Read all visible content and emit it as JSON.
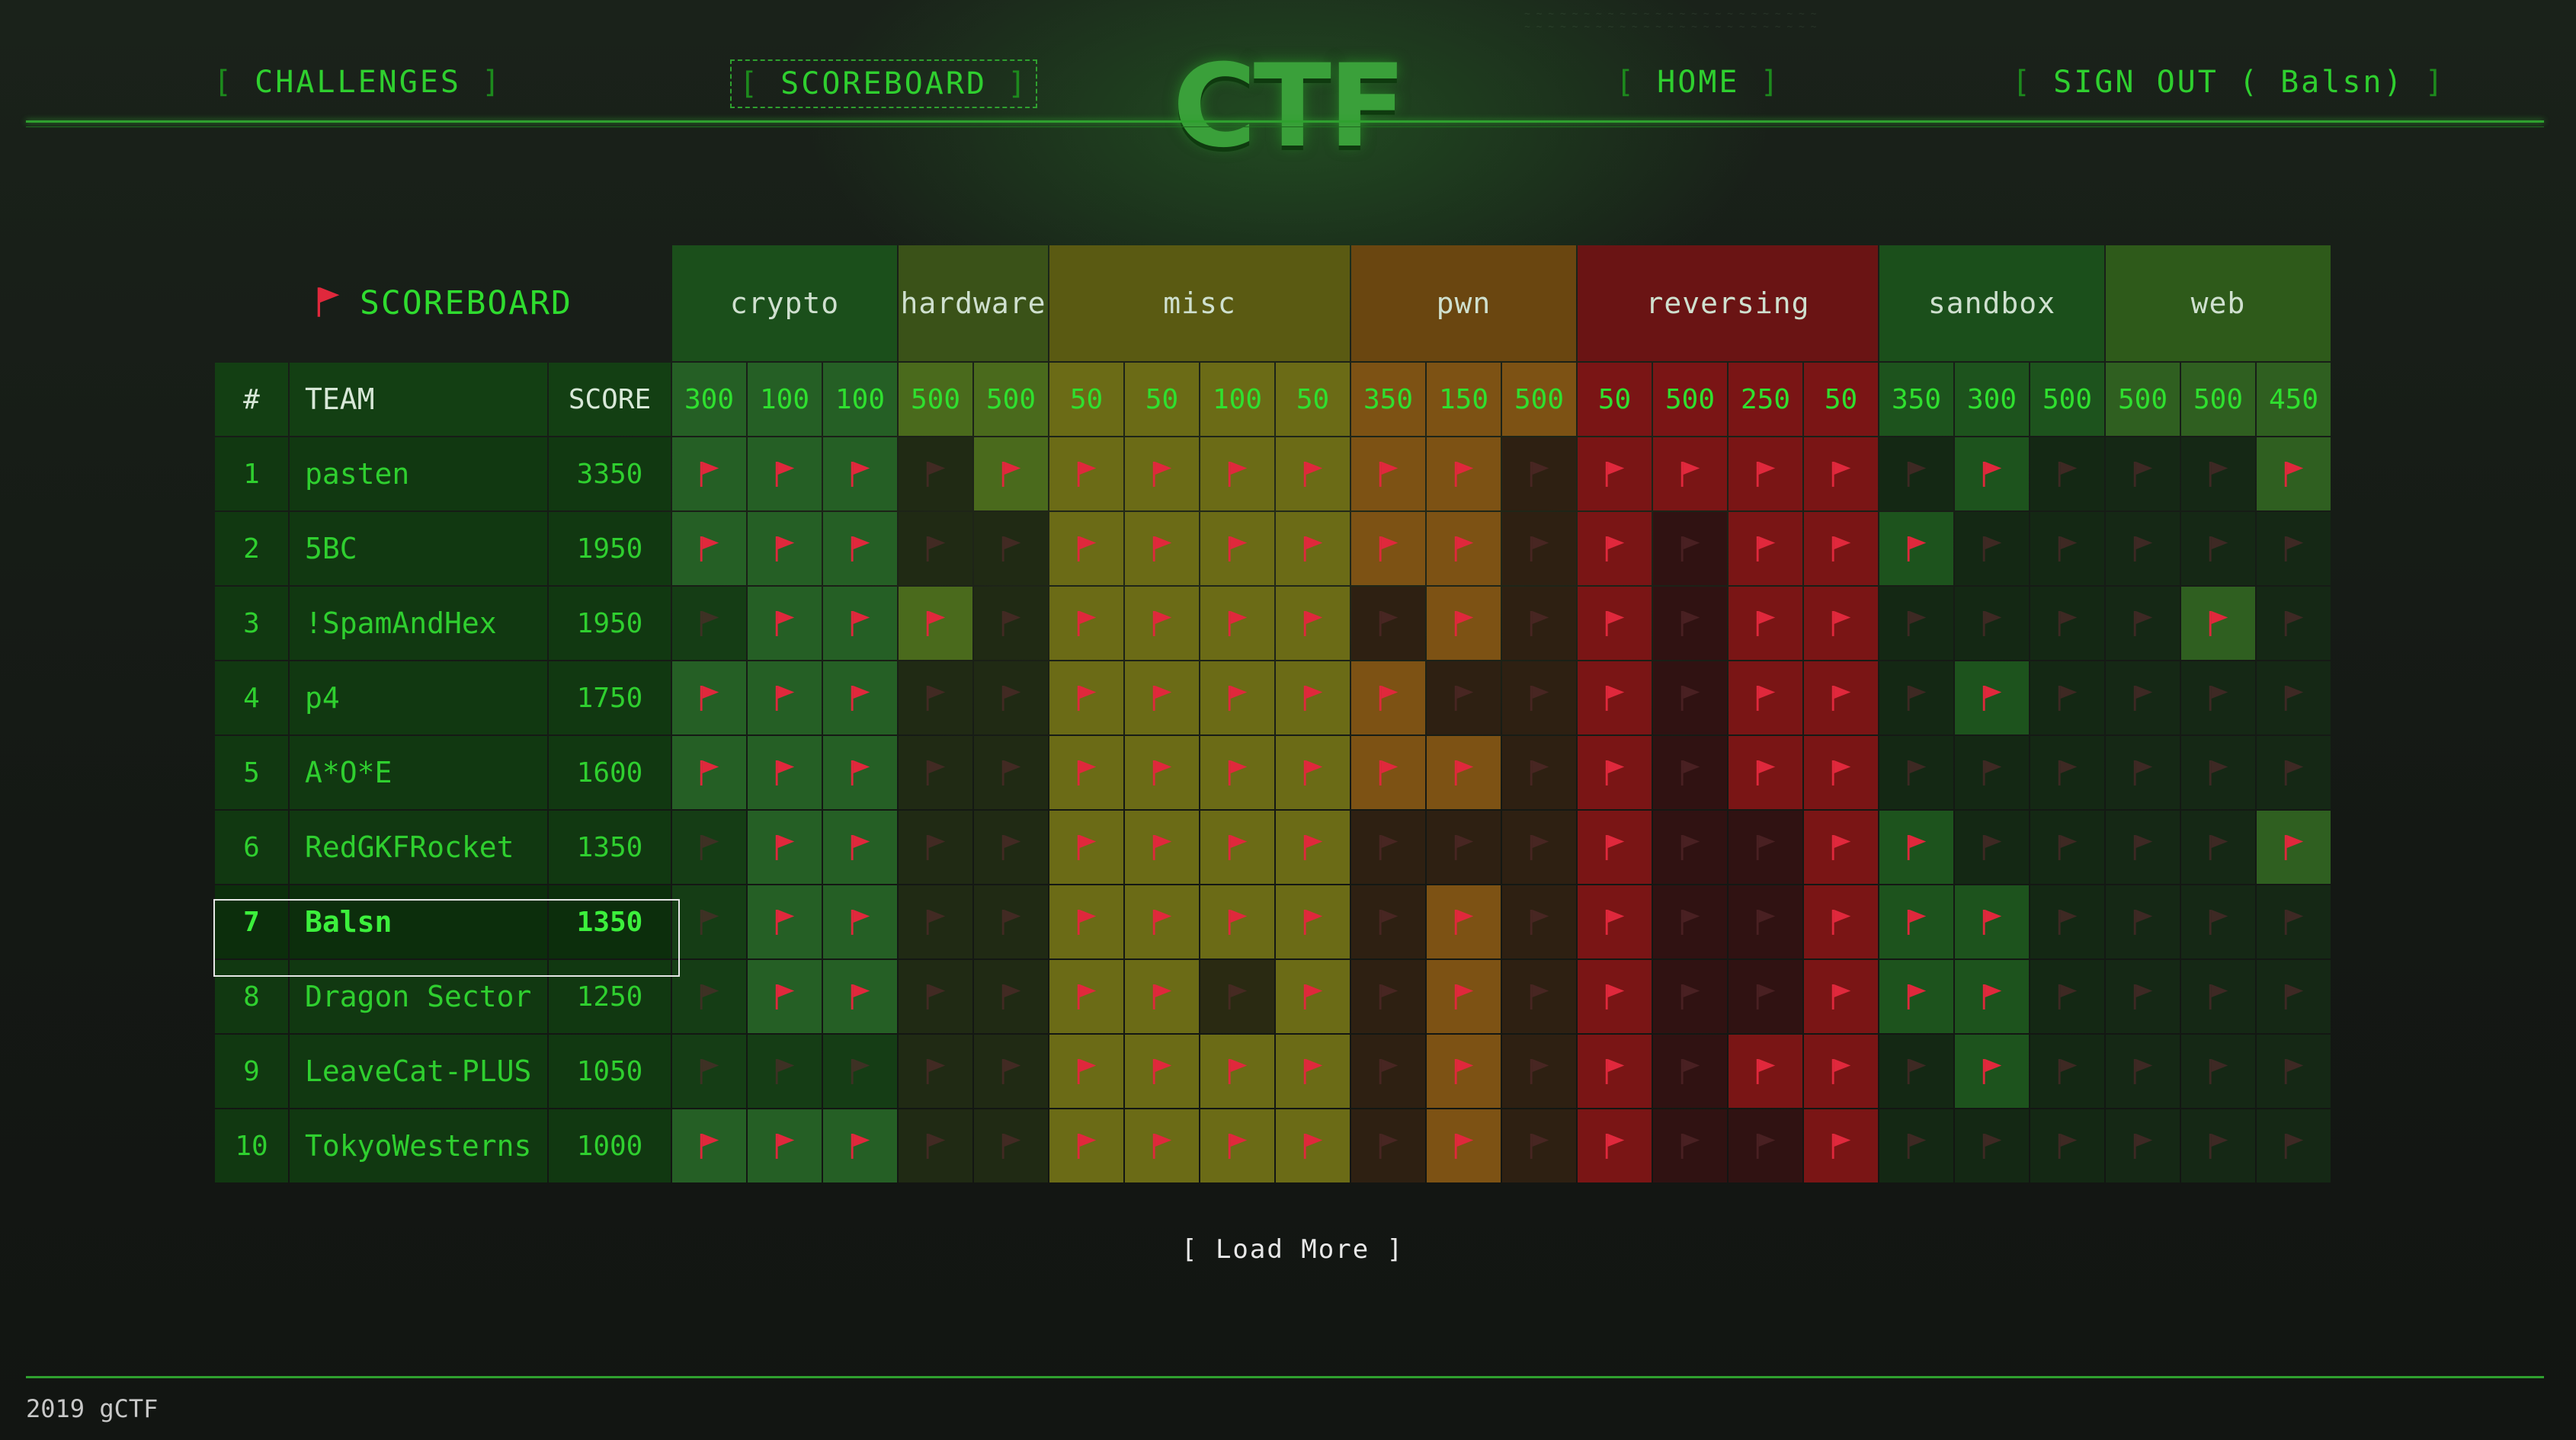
{
  "nav": {
    "challenges": "CHALLENGES",
    "scoreboard": "SCOREBOARD",
    "home": "HOME",
    "signout": "SIGN OUT ( Balsn)",
    "logo": "CTF"
  },
  "scoreboard_title": "SCOREBOARD",
  "headers": {
    "rank": "#",
    "team": "TEAM",
    "score": "SCORE"
  },
  "categories": [
    {
      "name": "crypto",
      "color": "#1b4f1b",
      "solved": "#255f25",
      "unsolved": "#153d15",
      "points": [
        "300",
        "100",
        "100"
      ]
    },
    {
      "name": "hardware",
      "color": "#3a5218",
      "solved": "#4a6a1c",
      "unsolved": "#202a14",
      "points": [
        "500",
        "500"
      ]
    },
    {
      "name": "misc",
      "color": "#5a5a12",
      "solved": "#6b6b16",
      "unsolved": "#2a2a12",
      "points": [
        "50",
        "50",
        "100",
        "50"
      ]
    },
    {
      "name": "pwn",
      "color": "#6a4610",
      "solved": "#7d5214",
      "unsolved": "#2e2012",
      "points": [
        "350",
        "150",
        "500"
      ]
    },
    {
      "name": "reversing",
      "color": "#6a1414",
      "solved": "#7a1515",
      "unsolved": "#301212",
      "points": [
        "50",
        "500",
        "250",
        "50"
      ]
    },
    {
      "name": "sandbox",
      "color": "#1b4f1b",
      "solved": "#1d531d",
      "unsolved": "#142814",
      "points": [
        "350",
        "300",
        "500"
      ]
    },
    {
      "name": "web",
      "color": "#2e5a1a",
      "solved": "#2f5f20",
      "unsolved": "#152815",
      "points": [
        "500",
        "500",
        "450"
      ]
    }
  ],
  "teams": [
    {
      "rank": "1",
      "name": "pasten",
      "score": "3350",
      "solves": [
        1,
        1,
        1,
        0,
        1,
        1,
        1,
        1,
        1,
        1,
        1,
        0,
        1,
        1,
        1,
        1,
        0,
        1,
        0,
        0,
        0,
        1
      ]
    },
    {
      "rank": "2",
      "name": "5BC",
      "score": "1950",
      "solves": [
        1,
        1,
        1,
        0,
        0,
        1,
        1,
        1,
        1,
        1,
        1,
        0,
        1,
        0,
        1,
        1,
        1,
        0,
        0,
        0,
        0,
        0
      ]
    },
    {
      "rank": "3",
      "name": "!SpamAndHex",
      "score": "1950",
      "solves": [
        0,
        1,
        1,
        1,
        0,
        1,
        1,
        1,
        1,
        0,
        1,
        0,
        1,
        0,
        1,
        1,
        0,
        0,
        0,
        0,
        1,
        0
      ]
    },
    {
      "rank": "4",
      "name": "p4",
      "score": "1750",
      "solves": [
        1,
        1,
        1,
        0,
        0,
        1,
        1,
        1,
        1,
        1,
        0,
        0,
        1,
        0,
        1,
        1,
        0,
        1,
        0,
        0,
        0,
        0
      ]
    },
    {
      "rank": "5",
      "name": "A*O*E",
      "score": "1600",
      "solves": [
        1,
        1,
        1,
        0,
        0,
        1,
        1,
        1,
        1,
        1,
        1,
        0,
        1,
        0,
        1,
        1,
        0,
        0,
        0,
        0,
        0,
        0
      ]
    },
    {
      "rank": "6",
      "name": "RedGKFRocket",
      "score": "1350",
      "solves": [
        0,
        1,
        1,
        0,
        0,
        1,
        1,
        1,
        1,
        0,
        0,
        0,
        1,
        0,
        0,
        1,
        1,
        0,
        0,
        0,
        0,
        1
      ]
    },
    {
      "rank": "7",
      "name": "Balsn",
      "score": "1350",
      "mine": true,
      "solves": [
        0,
        1,
        1,
        0,
        0,
        1,
        1,
        1,
        1,
        0,
        1,
        0,
        1,
        0,
        0,
        1,
        1,
        1,
        0,
        0,
        0,
        0
      ]
    },
    {
      "rank": "8",
      "name": "Dragon Sector",
      "score": "1250",
      "solves": [
        0,
        1,
        1,
        0,
        0,
        1,
        1,
        0,
        1,
        0,
        1,
        0,
        1,
        0,
        0,
        1,
        1,
        1,
        0,
        0,
        0,
        0
      ]
    },
    {
      "rank": "9",
      "name": "LeaveCat-PLUS",
      "score": "1050",
      "solves": [
        0,
        0,
        0,
        0,
        0,
        1,
        1,
        1,
        1,
        0,
        1,
        0,
        1,
        0,
        1,
        1,
        0,
        1,
        0,
        0,
        0,
        0
      ]
    },
    {
      "rank": "10",
      "name": "TokyoWesterns",
      "score": "1000",
      "solves": [
        1,
        1,
        1,
        0,
        0,
        1,
        1,
        1,
        1,
        0,
        1,
        0,
        1,
        0,
        0,
        1,
        0,
        0,
        0,
        0,
        0,
        0
      ]
    }
  ],
  "load_more": "[ Load More ]",
  "footer": "2019 gCTF",
  "colors": {
    "accent": "#2fcf2f",
    "flag": "#e0283c",
    "flag_dim": "#5a2a2e"
  }
}
